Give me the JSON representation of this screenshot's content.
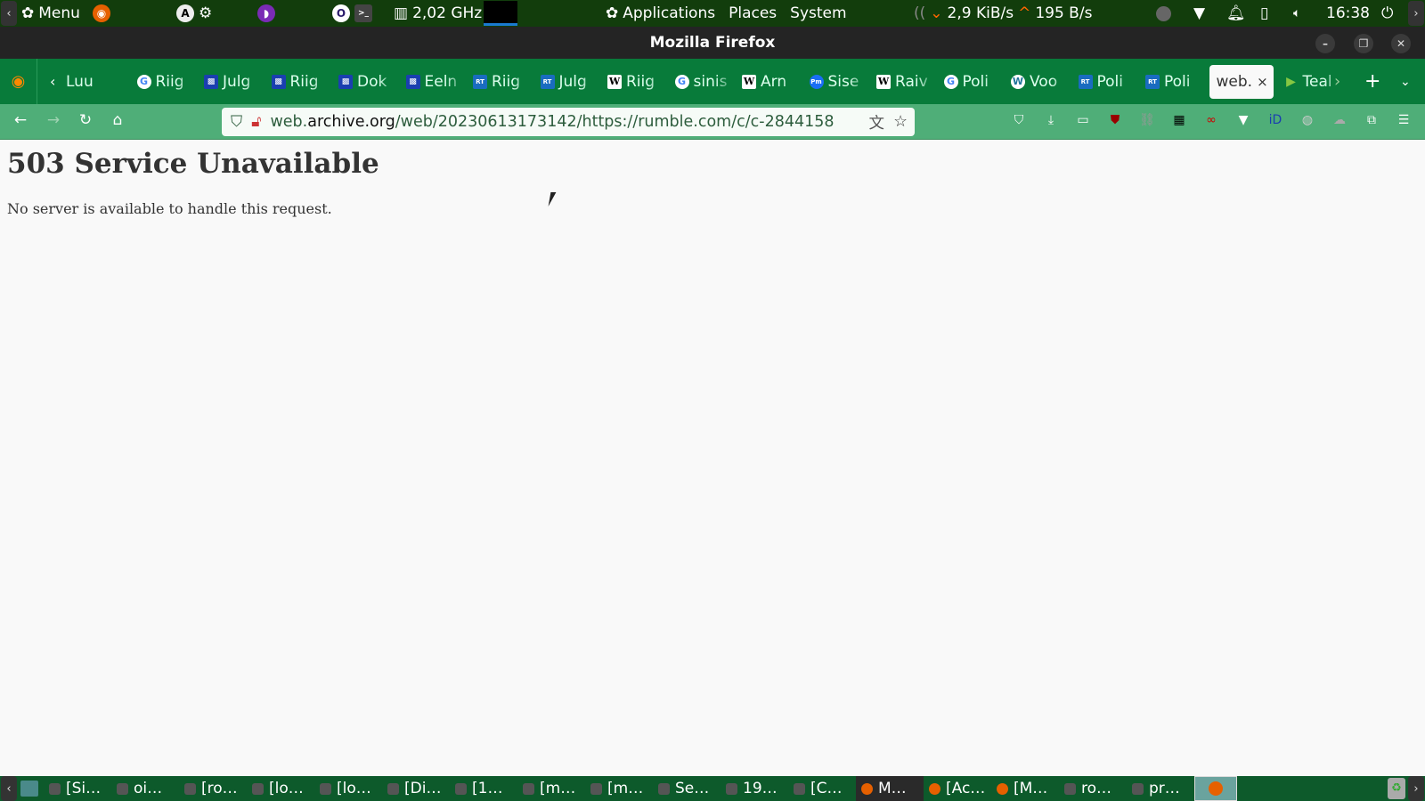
{
  "top_panel": {
    "menu_label": "Menu",
    "cpu_freq": "2,02 GHz",
    "applications": "Applications",
    "places": "Places",
    "system": "System",
    "net_down": "2,9 KiB/s",
    "net_up": "195 B/s",
    "clock": "16:38"
  },
  "window": {
    "title": "Mozilla Firefox"
  },
  "tabs": [
    {
      "label": "Luu",
      "icon": "none"
    },
    {
      "label": "Riig",
      "icon": "google"
    },
    {
      "label": "Julg",
      "icon": "grid"
    },
    {
      "label": "Riig",
      "icon": "grid"
    },
    {
      "label": "Dok",
      "icon": "grid"
    },
    {
      "label": "Eeln",
      "icon": "grid"
    },
    {
      "label": "Riig",
      "icon": "rt"
    },
    {
      "label": "Julg",
      "icon": "rt"
    },
    {
      "label": "Riig",
      "icon": "wikipedia"
    },
    {
      "label": "sinis",
      "icon": "google"
    },
    {
      "label": "Arn",
      "icon": "wikipedia"
    },
    {
      "label": "Sise",
      "icon": "pm"
    },
    {
      "label": "Raiv",
      "icon": "wikipedia"
    },
    {
      "label": "Poli",
      "icon": "google"
    },
    {
      "label": "Voo",
      "icon": "wordpress"
    },
    {
      "label": "Poli",
      "icon": "rt"
    },
    {
      "label": "Poli",
      "icon": "rt"
    }
  ],
  "active_tab": {
    "label": "web.",
    "close": "×"
  },
  "after_tab": {
    "label": "Teal",
    "icon": "rumble"
  },
  "url": {
    "prefix": "web.",
    "domain": "archive.org",
    "rest": "/web/20230613173142/https://rumble.com/c/c-2844158"
  },
  "page": {
    "heading": "503 Service Unavailable",
    "message": "No server is available to handle this request."
  },
  "taskbar": [
    "[Si…",
    "oi…",
    "[ro…",
    "[lo…",
    "[lo…",
    "[Di…",
    "[1…",
    "[m…",
    "[m…",
    "Se…",
    "19…",
    "[C…",
    "M…",
    "[Ac…",
    "[M…",
    "ro…",
    "pr…"
  ],
  "colors": {
    "panel": "#123d0c",
    "tabstrip": "#087b3a",
    "navbar": "#4fae78",
    "taskbar": "#0d5a2b"
  }
}
